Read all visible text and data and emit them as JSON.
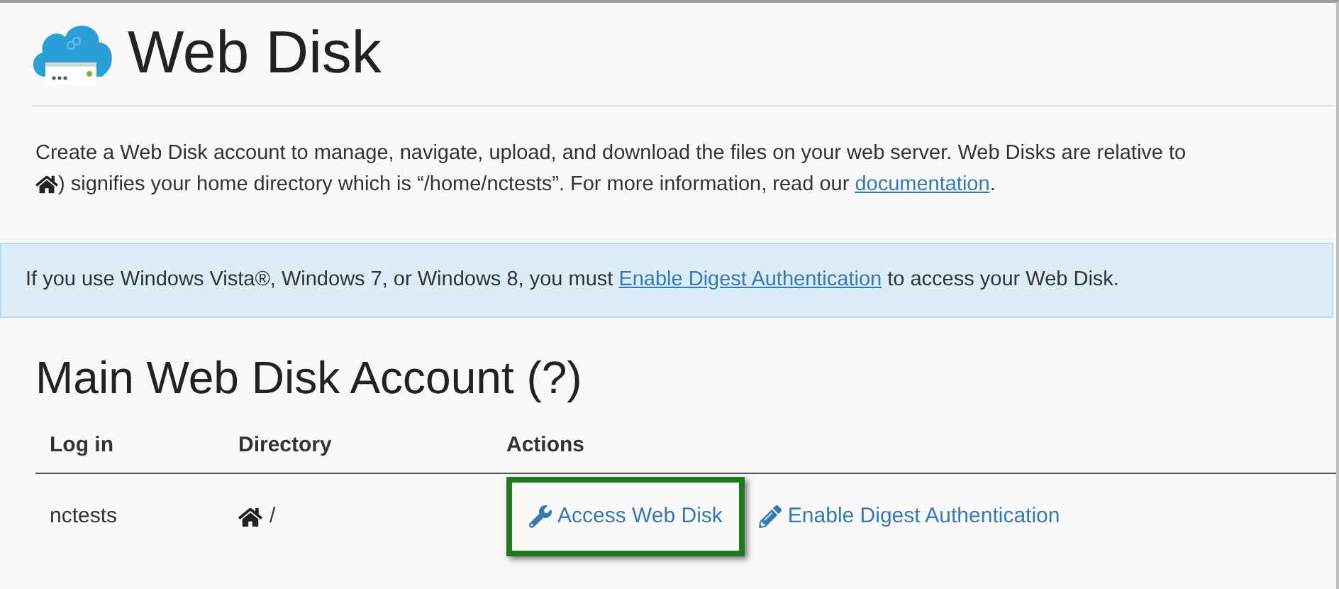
{
  "title": "Web Disk",
  "description": {
    "line_1": "Create a Web Disk account to manage, navigate, upload, and download the files on your web server. Web Disks are relative to",
    "line_2_before": ") signifies your home directory which is “/home/nctests”. For more information, read our",
    "link": "documentation",
    "line_2_after": "."
  },
  "alert": {
    "before": "If you use Windows Vista®, Windows 7, or Windows 8, you must",
    "link": "Enable Digest Authentication",
    "after": "to access your Web Disk."
  },
  "section_title": "Main Web Disk Account (?)",
  "table": {
    "columns": [
      "Log in",
      "Directory",
      "Actions"
    ],
    "rows": [
      {
        "login": "nctests",
        "directory": "/",
        "actions": [
          {
            "kind": "wrench",
            "label": "Access Web Disk",
            "highlighted": true
          },
          {
            "kind": "pencil",
            "label": "Enable Digest Authentication",
            "highlighted": false
          }
        ]
      }
    ]
  }
}
